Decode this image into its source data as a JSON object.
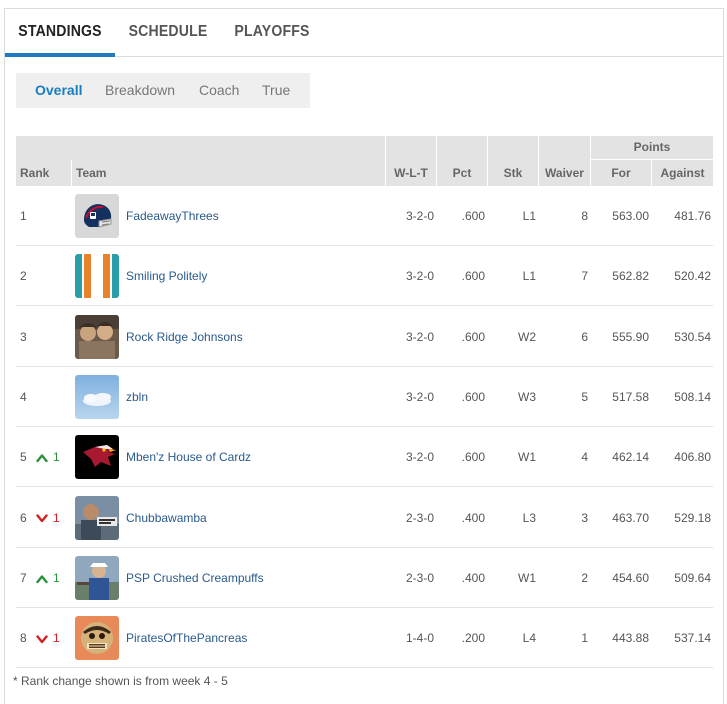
{
  "tabs": [
    "STANDINGS",
    "SCHEDULE",
    "PLAYOFFS"
  ],
  "subtabs": [
    "Overall",
    "Breakdown",
    "Coach",
    "True"
  ],
  "headers": {
    "group": "Points",
    "rank": "Rank",
    "team": "Team",
    "wlt": "W-L-T",
    "pct": "Pct",
    "stk": "Stk",
    "waiver": "Waiver",
    "for": "For",
    "against": "Against"
  },
  "rows": [
    {
      "rank": "1",
      "change": "",
      "dir": "",
      "team": "FadeawayThrees",
      "wlt": "3-2-0",
      "pct": ".600",
      "stk": "L1",
      "waiver": "8",
      "for": "563.00",
      "against": "481.76",
      "avatar": "helmet-avatar"
    },
    {
      "rank": "2",
      "change": "",
      "dir": "",
      "team": "Smiling Politely",
      "wlt": "3-2-0",
      "pct": ".600",
      "stk": "L1",
      "waiver": "7",
      "for": "562.82",
      "against": "520.42",
      "avatar": "stripes-avatar"
    },
    {
      "rank": "3",
      "change": "",
      "dir": "",
      "team": "Rock Ridge Johnsons",
      "wlt": "3-2-0",
      "pct": ".600",
      "stk": "W2",
      "waiver": "6",
      "for": "555.90",
      "against": "530.54",
      "avatar": "photo-avatar"
    },
    {
      "rank": "4",
      "change": "",
      "dir": "",
      "team": "zbln",
      "wlt": "3-2-0",
      "pct": ".600",
      "stk": "W3",
      "waiver": "5",
      "for": "517.58",
      "against": "508.14",
      "avatar": "sky-avatar"
    },
    {
      "rank": "5",
      "change": "1",
      "dir": "up",
      "team": "Mben'z House of Cardz",
      "wlt": "3-2-0",
      "pct": ".600",
      "stk": "W1",
      "waiver": "4",
      "for": "462.14",
      "against": "406.80",
      "avatar": "cardinal-avatar"
    },
    {
      "rank": "6",
      "change": "1",
      "dir": "down",
      "team": "Chubbawamba",
      "wlt": "2-3-0",
      "pct": ".400",
      "stk": "L3",
      "waiver": "3",
      "for": "463.70",
      "against": "529.18",
      "avatar": "person-avatar"
    },
    {
      "rank": "7",
      "change": "1",
      "dir": "up",
      "team": "PSP Crushed Creampuffs",
      "wlt": "2-3-0",
      "pct": ".400",
      "stk": "W1",
      "waiver": "2",
      "for": "454.60",
      "against": "509.64",
      "avatar": "person2-avatar"
    },
    {
      "rank": "8",
      "change": "1",
      "dir": "down",
      "team": "PiratesOfThePancreas",
      "wlt": "1-4-0",
      "pct": ".200",
      "stk": "L4",
      "waiver": "1",
      "for": "443.88",
      "against": "537.14",
      "avatar": "pirate-avatar"
    }
  ],
  "footnote": "* Rank change shown is from week 4 - 5",
  "colors": {
    "accent": "#1f7ac2",
    "link": "#2a5a8c",
    "up": "#2a8f3b",
    "down": "#cc2222",
    "header_bg": "#e3e3e3"
  }
}
